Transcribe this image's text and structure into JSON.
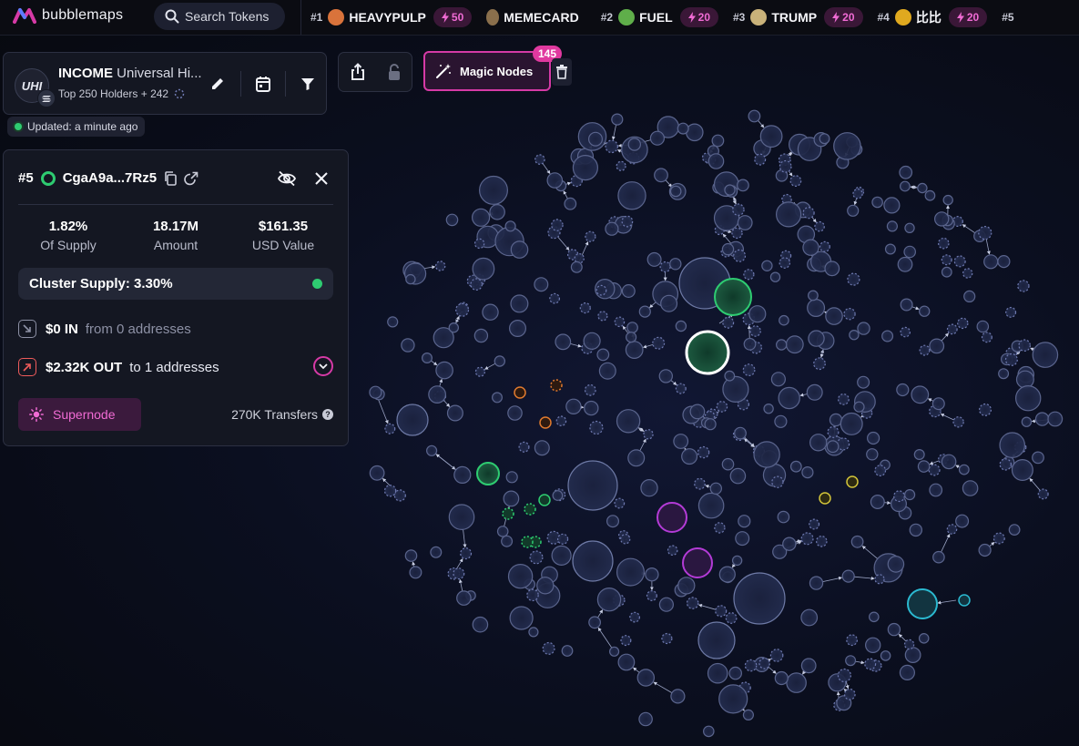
{
  "app": {
    "name": "bubblemaps"
  },
  "search": {
    "label": "Search Tokens"
  },
  "ticker": [
    {
      "rank": "#1",
      "name": "HEAVYPULP",
      "boost": "50",
      "color": "#d9733b"
    },
    {
      "rank": "",
      "name": "MEMECARD",
      "boost": "",
      "color": "#8a6f4c"
    },
    {
      "rank": "#2",
      "name": "FUEL",
      "boost": "20",
      "color": "#5fae4a"
    },
    {
      "rank": "#3",
      "name": "TRUMP",
      "boost": "20",
      "color": "#c9b27a"
    },
    {
      "rank": "#4",
      "name": "比比",
      "boost": "20",
      "color": "#e0a91f"
    },
    {
      "rank": "#5",
      "name": "",
      "boost": "",
      "color": ""
    }
  ],
  "token": {
    "symbol": "INCOME",
    "full_name": "Universal Hi...",
    "avatar_text": "UHI",
    "holders": "Top 250 Holders + 242"
  },
  "updated": {
    "text": "Updated: a minute ago"
  },
  "toolbar": {
    "magic_label": "Magic Nodes",
    "magic_count": "145"
  },
  "detail": {
    "rank": "#5",
    "address": "CgaA9a...7Rz5",
    "supply": "1.82%",
    "supply_label": "Of Supply",
    "amount": "18.17M",
    "amount_label": "Amount",
    "usd": "$161.35",
    "usd_label": "USD Value",
    "cluster": "Cluster Supply: 3.30%",
    "in_amount": "$0 IN",
    "in_from": "from 0 addresses",
    "out_amount": "$2.32K OUT",
    "out_to": "to 1 addresses",
    "supernode": "Supernode",
    "transfers": "270K Transfers"
  },
  "colors": {
    "accent_pink": "#d63aa6",
    "green": "#2ecc71",
    "bubble": "#4a5578",
    "bubble_fill": "#1a2038"
  }
}
